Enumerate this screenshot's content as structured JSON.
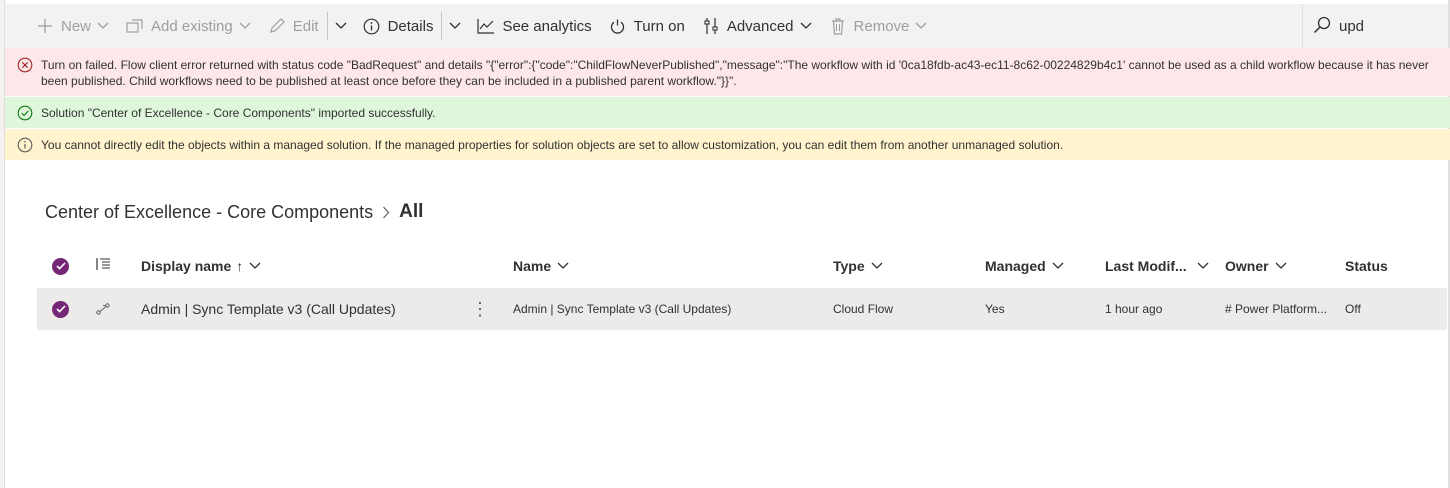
{
  "toolbar": {
    "new_label": "New",
    "add_existing_label": "Add existing",
    "edit_label": "Edit",
    "details_label": "Details",
    "see_analytics_label": "See analytics",
    "turn_on_label": "Turn on",
    "advanced_label": "Advanced",
    "remove_label": "Remove",
    "search_value": "upd"
  },
  "messages": {
    "error": "Turn on failed. Flow client error returned with status code \"BadRequest\" and details \"{\"error\":{\"code\":\"ChildFlowNeverPublished\",\"message\":\"The workflow with id '0ca18fdb-ac43-ec11-8c62-00224829b4c1' cannot be used as a child workflow because it has never been published. Child workflows need to be published at least once before they can be included in a published parent workflow.\"}}\".",
    "success": "Solution \"Center of Excellence - Core Components\" imported successfully.",
    "warning": "You cannot directly edit the objects within a managed solution. If the managed properties for solution objects are set to allow customization, you can edit them from another unmanaged solution."
  },
  "breadcrumb": {
    "parent": "Center of Excellence - Core Components",
    "current": "All"
  },
  "table": {
    "columns": {
      "display_name": "Display name",
      "sort_arrow": "↑",
      "name": "Name",
      "type": "Type",
      "managed": "Managed",
      "last_modified": "Last Modif...",
      "owner": "Owner",
      "status": "Status"
    },
    "rows": [
      {
        "display_name": "Admin | Sync Template v3 (Call Updates)",
        "more": "⋮",
        "name": "Admin | Sync Template v3 (Call Updates)",
        "type": "Cloud Flow",
        "managed": "Yes",
        "last_modified": "1 hour ago",
        "owner": "# Power Platform...",
        "status": "Off"
      }
    ]
  },
  "colors": {
    "accent": "#742774",
    "error_bg": "#fde7e9",
    "success_bg": "#dff6dd",
    "warning_bg": "#fff4ce",
    "command_bar_bg": "#f3f2f1",
    "selected_row_bg": "#edebe9"
  }
}
